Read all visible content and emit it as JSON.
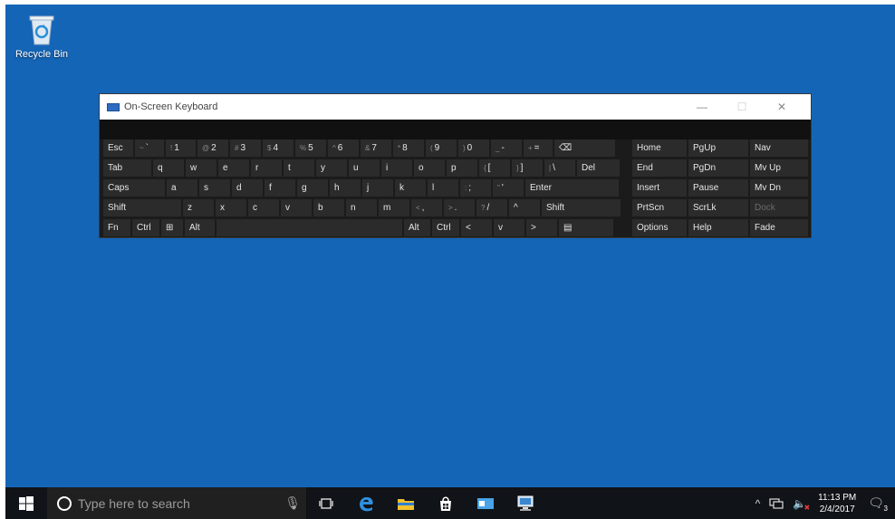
{
  "desktop": {
    "background": "#1565b7",
    "icons": [
      {
        "label": "Recycle Bin",
        "icon": "recycle-bin-icon"
      }
    ]
  },
  "osk": {
    "title": "On-Screen Keyboard",
    "window_controls": {
      "minimize": "—",
      "maximize": "☐",
      "close": "✕"
    },
    "rows": [
      [
        {
          "label": "Esc"
        },
        {
          "label": "`",
          "shift": "~"
        },
        {
          "label": "1",
          "shift": "!"
        },
        {
          "label": "2",
          "shift": "@"
        },
        {
          "label": "3",
          "shift": "#"
        },
        {
          "label": "4",
          "shift": "$"
        },
        {
          "label": "5",
          "shift": "%"
        },
        {
          "label": "6",
          "shift": "^"
        },
        {
          "label": "7",
          "shift": "&"
        },
        {
          "label": "8",
          "shift": "*"
        },
        {
          "label": "9",
          "shift": "("
        },
        {
          "label": "0",
          "shift": ")"
        },
        {
          "label": "-",
          "shift": "_"
        },
        {
          "label": "=",
          "shift": "+"
        },
        {
          "label": "⌫"
        }
      ],
      [
        {
          "label": "Tab"
        },
        {
          "label": "q"
        },
        {
          "label": "w"
        },
        {
          "label": "e"
        },
        {
          "label": "r"
        },
        {
          "label": "t"
        },
        {
          "label": "y"
        },
        {
          "label": "u"
        },
        {
          "label": "i"
        },
        {
          "label": "o"
        },
        {
          "label": "p"
        },
        {
          "label": "[",
          "shift": "{"
        },
        {
          "label": "]",
          "shift": "}"
        },
        {
          "label": "\\",
          "shift": "|"
        },
        {
          "label": "Del"
        }
      ],
      [
        {
          "label": "Caps"
        },
        {
          "label": "a"
        },
        {
          "label": "s"
        },
        {
          "label": "d"
        },
        {
          "label": "f"
        },
        {
          "label": "g"
        },
        {
          "label": "h"
        },
        {
          "label": "j"
        },
        {
          "label": "k"
        },
        {
          "label": "l"
        },
        {
          "label": ";",
          "shift": ":"
        },
        {
          "label": "'",
          "shift": "\""
        },
        {
          "label": "Enter"
        }
      ],
      [
        {
          "label": "Shift"
        },
        {
          "label": "z"
        },
        {
          "label": "x"
        },
        {
          "label": "c"
        },
        {
          "label": "v"
        },
        {
          "label": "b"
        },
        {
          "label": "n"
        },
        {
          "label": "m"
        },
        {
          "label": ",",
          "shift": "<"
        },
        {
          "label": ".",
          "shift": ">"
        },
        {
          "label": "/",
          "shift": "?"
        },
        {
          "label": "^"
        },
        {
          "label": "Shift"
        }
      ],
      [
        {
          "label": "Fn"
        },
        {
          "label": "Ctrl"
        },
        {
          "label": "⊞"
        },
        {
          "label": "Alt"
        },
        {
          "label": ""
        },
        {
          "label": "Alt"
        },
        {
          "label": "Ctrl"
        },
        {
          "label": "<"
        },
        {
          "label": "v"
        },
        {
          "label": ">"
        },
        {
          "label": "▤"
        }
      ]
    ],
    "nav_keys": [
      [
        "Home",
        "PgUp",
        "Nav"
      ],
      [
        "End",
        "PgDn",
        "Mv Up"
      ],
      [
        "Insert",
        "Pause",
        "Mv Dn"
      ],
      [
        "PrtScn",
        "ScrLk",
        "Dock"
      ],
      [
        "Options",
        "Help",
        "Fade"
      ]
    ]
  },
  "taskbar": {
    "search_placeholder": "Type here to search",
    "time": "11:13 PM",
    "date": "2/4/2017",
    "notification_count": "3",
    "pinned": [
      "task-view-icon",
      "edge-icon",
      "file-explorer-icon",
      "store-icon",
      "mail-icon",
      "network-app-icon"
    ]
  }
}
